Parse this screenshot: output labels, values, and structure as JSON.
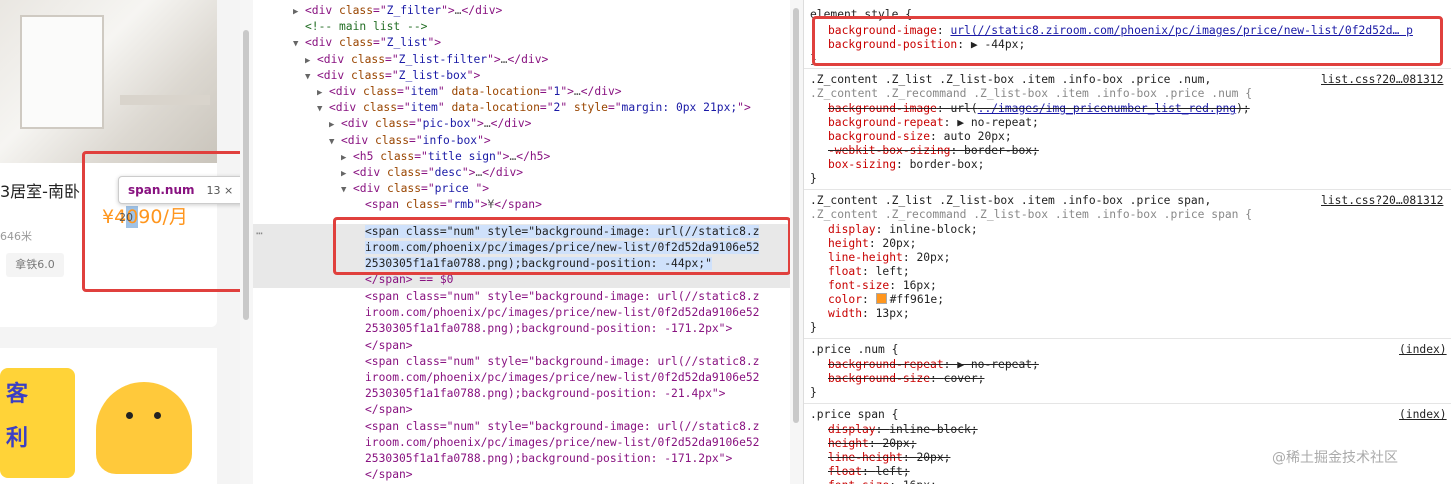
{
  "preview": {
    "room_title": "3居室-南卧",
    "price_text_prefix": "¥4",
    "price_text_highlight": "0",
    "price_text_suffix": "90/月",
    "distance": "646米",
    "tag": "拿铁6.0",
    "banner_chars": [
      "客",
      "利"
    ],
    "tooltip_name": "span.num",
    "tooltip_dims": "13 × 20"
  },
  "elements_panel": {
    "lines": [
      {
        "indent": 3,
        "arrow": "▶",
        "parts": [
          [
            "tg",
            "<div "
          ],
          [
            "at",
            "class"
          ],
          [
            "tg",
            "=\""
          ],
          [
            "av",
            "Z_filter"
          ],
          [
            "tg",
            "\">"
          ],
          [
            "ar",
            "…"
          ],
          [
            "tg",
            "</div>"
          ]
        ]
      },
      {
        "indent": 3,
        "arrow": "",
        "parts": [
          [
            "cm",
            "<!-- main list -->"
          ]
        ]
      },
      {
        "indent": 3,
        "arrow": "▼",
        "parts": [
          [
            "tg",
            "<div "
          ],
          [
            "at",
            "class"
          ],
          [
            "tg",
            "=\""
          ],
          [
            "av",
            "Z_list"
          ],
          [
            "tg",
            "\">"
          ]
        ]
      },
      {
        "indent": 4,
        "arrow": "▶",
        "parts": [
          [
            "tg",
            "<div "
          ],
          [
            "at",
            "class"
          ],
          [
            "tg",
            "=\""
          ],
          [
            "av",
            "Z_list-filter"
          ],
          [
            "tg",
            "\">"
          ],
          [
            "ar",
            "…"
          ],
          [
            "tg",
            "</div>"
          ]
        ]
      },
      {
        "indent": 4,
        "arrow": "▼",
        "parts": [
          [
            "tg",
            "<div "
          ],
          [
            "at",
            "class"
          ],
          [
            "tg",
            "=\""
          ],
          [
            "av",
            "Z_list-box"
          ],
          [
            "tg",
            "\">"
          ]
        ]
      },
      {
        "indent": 5,
        "arrow": "▶",
        "parts": [
          [
            "tg",
            "<div "
          ],
          [
            "at",
            "class"
          ],
          [
            "tg",
            "=\""
          ],
          [
            "av",
            "item"
          ],
          [
            "tg",
            "\" "
          ],
          [
            "at",
            "data-location"
          ],
          [
            "tg",
            "=\""
          ],
          [
            "av",
            "1"
          ],
          [
            "tg",
            "\">"
          ],
          [
            "ar",
            "…"
          ],
          [
            "tg",
            "</div>"
          ]
        ]
      },
      {
        "indent": 5,
        "arrow": "▼",
        "parts": [
          [
            "tg",
            "<div "
          ],
          [
            "at",
            "class"
          ],
          [
            "tg",
            "=\""
          ],
          [
            "av",
            "item"
          ],
          [
            "tg",
            "\" "
          ],
          [
            "at",
            "data-location"
          ],
          [
            "tg",
            "=\""
          ],
          [
            "av",
            "2"
          ],
          [
            "tg",
            "\" "
          ],
          [
            "at",
            "style"
          ],
          [
            "tg",
            "=\""
          ],
          [
            "av",
            "margin: 0px 21px;"
          ],
          [
            "tg",
            "\">"
          ]
        ]
      },
      {
        "indent": 6,
        "arrow": "▶",
        "parts": [
          [
            "tg",
            "<div "
          ],
          [
            "at",
            "class"
          ],
          [
            "tg",
            "=\""
          ],
          [
            "av",
            "pic-box"
          ],
          [
            "tg",
            "\">"
          ],
          [
            "ar",
            "…"
          ],
          [
            "tg",
            "</div>"
          ]
        ]
      },
      {
        "indent": 6,
        "arrow": "▼",
        "parts": [
          [
            "tg",
            "<div "
          ],
          [
            "at",
            "class"
          ],
          [
            "tg",
            "=\""
          ],
          [
            "av",
            "info-box"
          ],
          [
            "tg",
            "\">"
          ]
        ]
      },
      {
        "indent": 7,
        "arrow": "▶",
        "parts": [
          [
            "tg",
            "<h5 "
          ],
          [
            "at",
            "class"
          ],
          [
            "tg",
            "=\""
          ],
          [
            "av",
            "title sign"
          ],
          [
            "tg",
            "\">"
          ],
          [
            "ar",
            "…"
          ],
          [
            "tg",
            "</h5>"
          ]
        ]
      },
      {
        "indent": 7,
        "arrow": "▶",
        "parts": [
          [
            "tg",
            "<div "
          ],
          [
            "at",
            "class"
          ],
          [
            "tg",
            "=\""
          ],
          [
            "av",
            "desc"
          ],
          [
            "tg",
            "\">"
          ],
          [
            "ar",
            "…"
          ],
          [
            "tg",
            "</div>"
          ]
        ]
      },
      {
        "indent": 7,
        "arrow": "▼",
        "parts": [
          [
            "tg",
            "<div "
          ],
          [
            "at",
            "class"
          ],
          [
            "tg",
            "=\""
          ],
          [
            "av",
            "price "
          ],
          [
            "tg",
            "\">"
          ]
        ]
      },
      {
        "indent": 8,
        "arrow": "",
        "parts": [
          [
            "tg",
            "<span "
          ],
          [
            "at",
            "class"
          ],
          [
            "tg",
            "=\""
          ],
          [
            "av",
            "rmb"
          ],
          [
            "tg",
            "\">"
          ],
          [
            "ar",
            "¥"
          ],
          [
            "tg",
            "</span>"
          ]
        ]
      }
    ],
    "selected_lines": [
      "<span class=\"num\" style=\"background-image: url(//static8.z",
      "iroom.com/phoenix/pc/images/price/new-list/0f2d52da9106e52",
      "2530305f1a1fa0788.png);background-position: -44px;\""
    ],
    "selected_tail": "</span> == $0",
    "following_lines": [
      "<span class=\"num\" style=\"background-image: url(//static8.z",
      "iroom.com/phoenix/pc/images/price/new-list/0f2d52da9106e52",
      "2530305f1a1fa0788.png);background-position: -171.2px\">",
      "</span>",
      "<span class=\"num\" style=\"background-image: url(//static8.z",
      "iroom.com/phoenix/pc/images/price/new-list/0f2d52da9106e52",
      "2530305f1a1fa0788.png);background-position: -21.4px\">",
      "</span>",
      "<span class=\"num\" style=\"background-image: url(//static8.z",
      "iroom.com/phoenix/pc/images/price/new-list/0f2d52da9106e52",
      "2530305f1a1fa0788.png);background-position: -171.2px\">",
      "</span>"
    ]
  },
  "styles_panel": {
    "element_style_header": "element.style {",
    "element_bg_name": "background-image",
    "element_bg_value": "url(//static8.ziroom.com/phoenix/pc/images/price/new-list/0f2d52d… p",
    "element_pos_name": "background-position",
    "element_pos_value": "▶ -44px;",
    "rule1_selector": ".Z_content .Z_list .Z_list-box .item .info-box .price .num,",
    "rule1_selector2": ".Z_content .Z_recommand .Z_list-box .item .info-box .price .num {",
    "rule1_source": "list.css?20…081312",
    "rule1_props": [
      {
        "name": "background-image",
        "value": "url(../images/img_pricenumber_list_red.png);",
        "struck": true
      },
      {
        "name": "background-repeat",
        "value": "▶ no-repeat;",
        "struck": false
      },
      {
        "name": "background-size",
        "value": "auto 20px;",
        "struck": false
      },
      {
        "name": "-webkit-box-sizing",
        "value": "border-box;",
        "struck": true
      },
      {
        "name": "box-sizing",
        "value": "border-box;",
        "struck": false
      }
    ],
    "rule2_selector": ".Z_content .Z_list .Z_list-box .item .info-box .price span,",
    "rule2_selector2": ".Z_content .Z_recommand .Z_list-box .item .info-box .price span {",
    "rule2_source": "list.css?20…081312",
    "rule2_props": [
      {
        "name": "display",
        "value": "inline-block;"
      },
      {
        "name": "height",
        "value": "20px;"
      },
      {
        "name": "line-height",
        "value": "20px;"
      },
      {
        "name": "float",
        "value": "left;"
      },
      {
        "name": "font-size",
        "value": "16px;"
      },
      {
        "name": "color",
        "value": "#ff961e;"
      },
      {
        "name": "width",
        "value": "13px;"
      }
    ],
    "rule3_selector": ".price .num {",
    "rule3_source": "(index)",
    "rule3_props": [
      {
        "name": "background-repeat",
        "value": "▶ no-repeat;"
      },
      {
        "name": "background-size",
        "value": "cover;"
      }
    ],
    "rule4_selector": ".price span {",
    "rule4_source": "(index)",
    "rule4_props": [
      {
        "name": "display",
        "value": "inline-block;"
      },
      {
        "name": "height",
        "value": "20px;"
      },
      {
        "name": "line-height",
        "value": "20px;"
      },
      {
        "name": "float",
        "value": "left;"
      },
      {
        "name": "font-size",
        "value": "16px;"
      }
    ],
    "closing_brace": "}"
  },
  "watermark": "@稀土掘金技术社区",
  "colors": {
    "accent_orange": "#ff961e",
    "highlight_red": "#e0403d"
  }
}
